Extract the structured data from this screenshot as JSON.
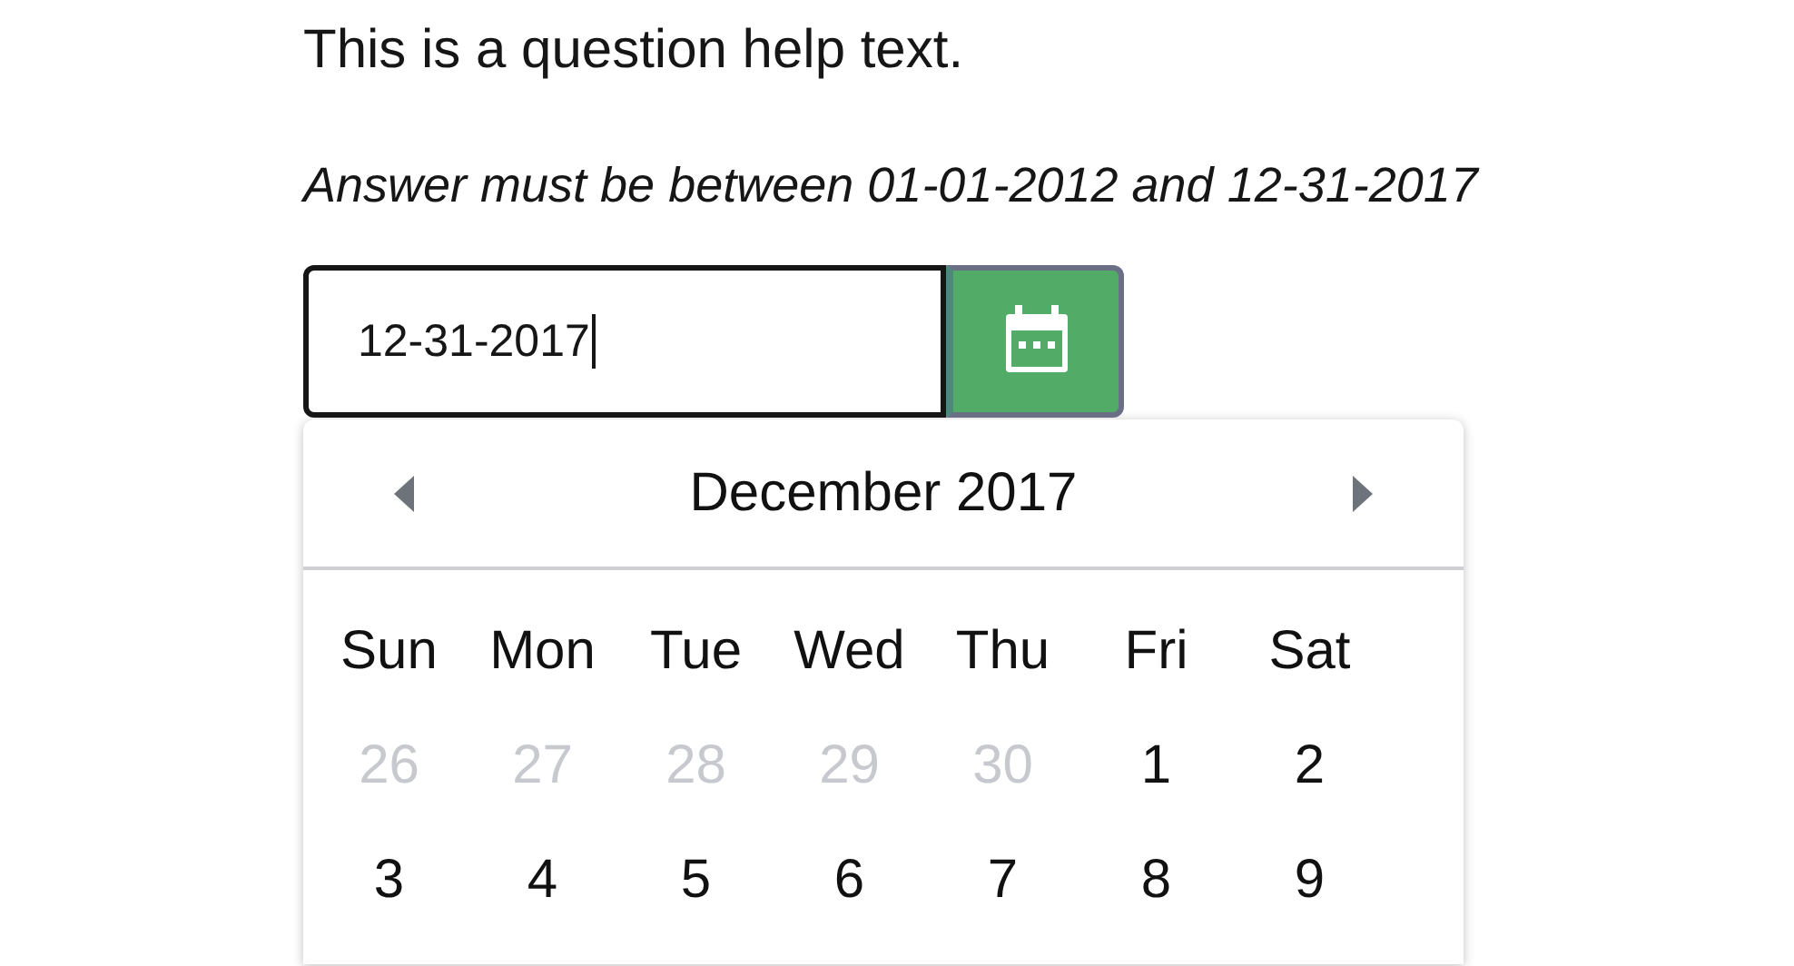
{
  "help_text": "This is a question help text.",
  "validation_text": "Answer must be between 01-01-2012 and 12-31-2017",
  "date_field": {
    "value": "12-31-2017",
    "focused": true
  },
  "calendar": {
    "month_label": "December 2017",
    "weekdays": [
      "Sun",
      "Mon",
      "Tue",
      "Wed",
      "Thu",
      "Fri",
      "Sat"
    ],
    "days": [
      {
        "label": "26",
        "outside": true
      },
      {
        "label": "27",
        "outside": true
      },
      {
        "label": "28",
        "outside": true
      },
      {
        "label": "29",
        "outside": true
      },
      {
        "label": "30",
        "outside": true
      },
      {
        "label": "1",
        "outside": false
      },
      {
        "label": "2",
        "outside": false
      },
      {
        "label": "3",
        "outside": false
      },
      {
        "label": "4",
        "outside": false
      },
      {
        "label": "5",
        "outside": false
      },
      {
        "label": "6",
        "outside": false
      },
      {
        "label": "7",
        "outside": false
      },
      {
        "label": "8",
        "outside": false
      },
      {
        "label": "9",
        "outside": false
      }
    ]
  }
}
